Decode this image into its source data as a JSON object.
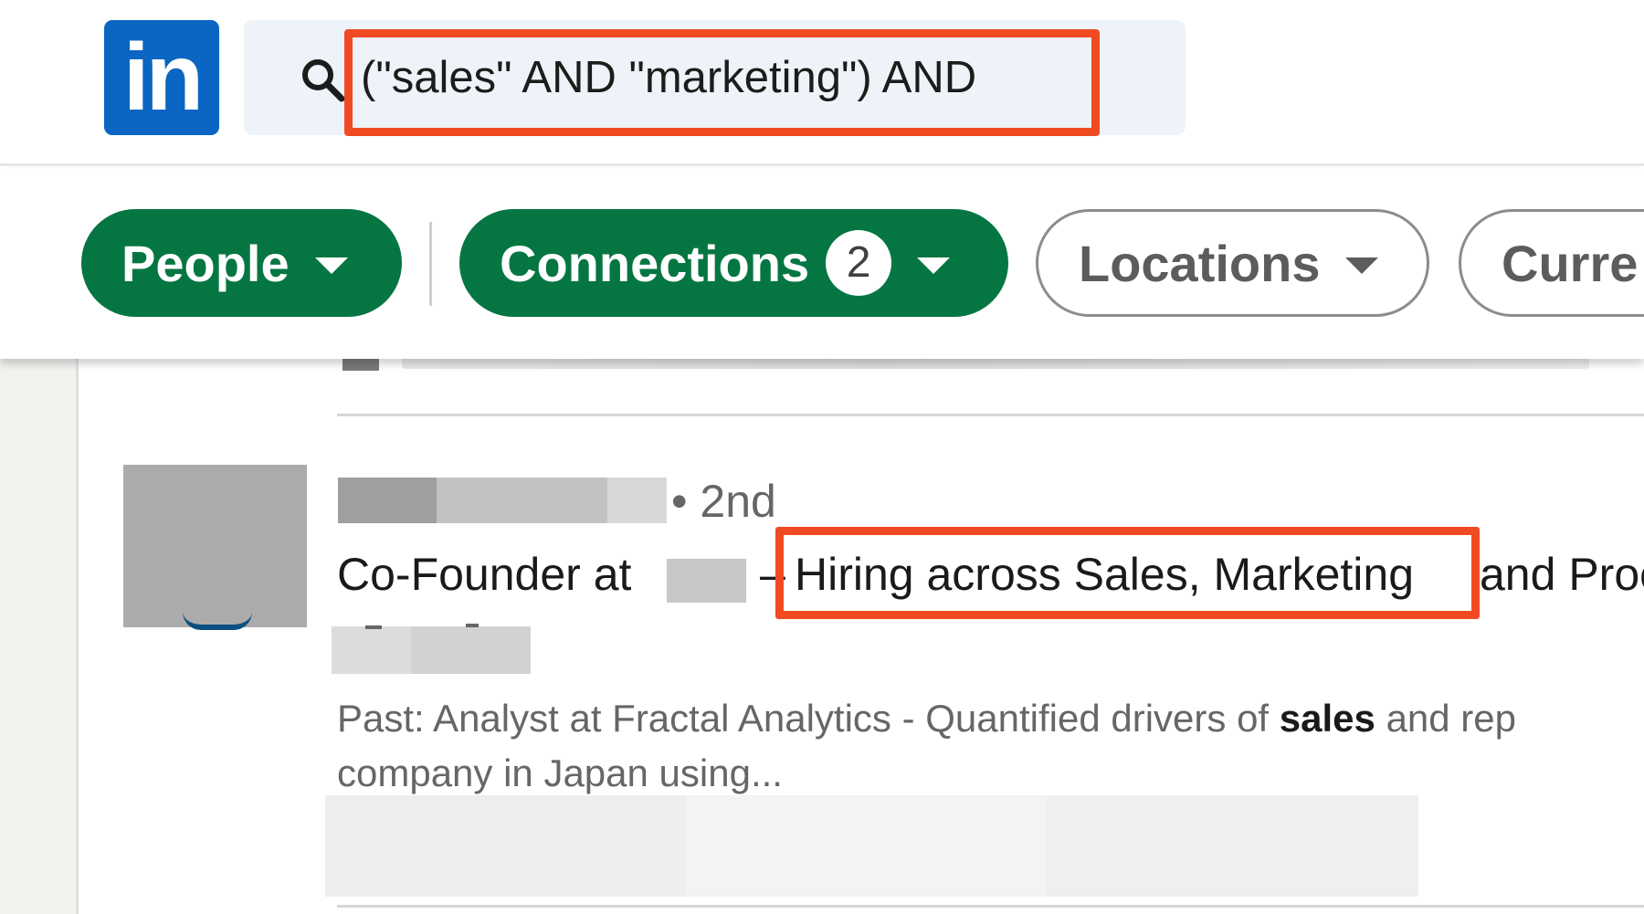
{
  "header": {
    "logo_text": "in",
    "search": {
      "value": "(\"sales\" AND \"marketing\") AND"
    }
  },
  "filters": {
    "people_label": "People",
    "connections_label": "Connections",
    "connections_count": "2",
    "locations_label": "Locations",
    "current_label": "Curre"
  },
  "result": {
    "degree": "• 2nd",
    "headline_prefix": "Co-Founder at",
    "headline_dash": "–",
    "headline_highlight": "Hiring across Sales, Marketing",
    "headline_tail": "and Proc",
    "past_prefix": "Past: Analyst at Fractal Analytics - Quantified drivers of",
    "past_bold": "sales",
    "past_suffix": "and rep",
    "past_line2": "company in Japan using..."
  },
  "colors": {
    "brand": "#0a66c2",
    "active_pill": "#057642",
    "annotation": "#f04a22"
  }
}
